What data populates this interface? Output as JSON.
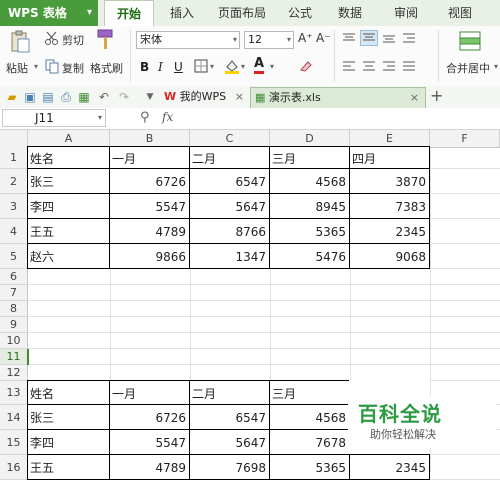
{
  "app": {
    "title": "WPS 表格"
  },
  "ribbon_tabs": [
    "开始",
    "插入",
    "页面布局",
    "公式",
    "数据",
    "审阅",
    "视图"
  ],
  "ribbon": {
    "paste_label": "粘贴",
    "cut_label": "剪切",
    "copy_label": "复制",
    "format_painter_label": "格式刷",
    "font_name": "宋体",
    "font_size": "12",
    "bold": "B",
    "italic": "I",
    "underline": "U",
    "font_color_letter": "A",
    "grow_font": "A⁺",
    "shrink_font": "A⁻",
    "merge_center_label": "合并居中"
  },
  "doc_tabs": [
    {
      "label": "我的WPS",
      "active": false
    },
    {
      "label": "演示表.xls",
      "active": true
    }
  ],
  "formula_bar": {
    "cell_ref": "J11",
    "fx": "fx",
    "value": ""
  },
  "columns": [
    "A",
    "B",
    "C",
    "D",
    "E",
    "F"
  ],
  "rows": [
    "1",
    "2",
    "3",
    "4",
    "5",
    "6",
    "7",
    "8",
    "9",
    "10",
    "11",
    "12",
    "13",
    "14",
    "15",
    "16"
  ],
  "selected_row": "11",
  "table1": {
    "header": [
      "姓名",
      "一月",
      "二月",
      "三月",
      "四月"
    ],
    "body": [
      [
        "张三",
        "6726",
        "6547",
        "4568",
        "3870"
      ],
      [
        "李四",
        "5547",
        "5647",
        "8945",
        "7383"
      ],
      [
        "王五",
        "4789",
        "8766",
        "5365",
        "2345"
      ],
      [
        "赵六",
        "9866",
        "1347",
        "5476",
        "9068"
      ]
    ]
  },
  "table2": {
    "header": [
      "姓名",
      "一月",
      "二月",
      "三月",
      ""
    ],
    "body": [
      [
        "张三",
        "6726",
        "6547",
        "4568",
        ""
      ],
      [
        "李四",
        "5547",
        "5647",
        "7678",
        ""
      ],
      [
        "王五",
        "4789",
        "7698",
        "5365",
        "2345"
      ]
    ]
  },
  "watermark": {
    "main": "百科全说",
    "sub": "助你轻松解决"
  }
}
